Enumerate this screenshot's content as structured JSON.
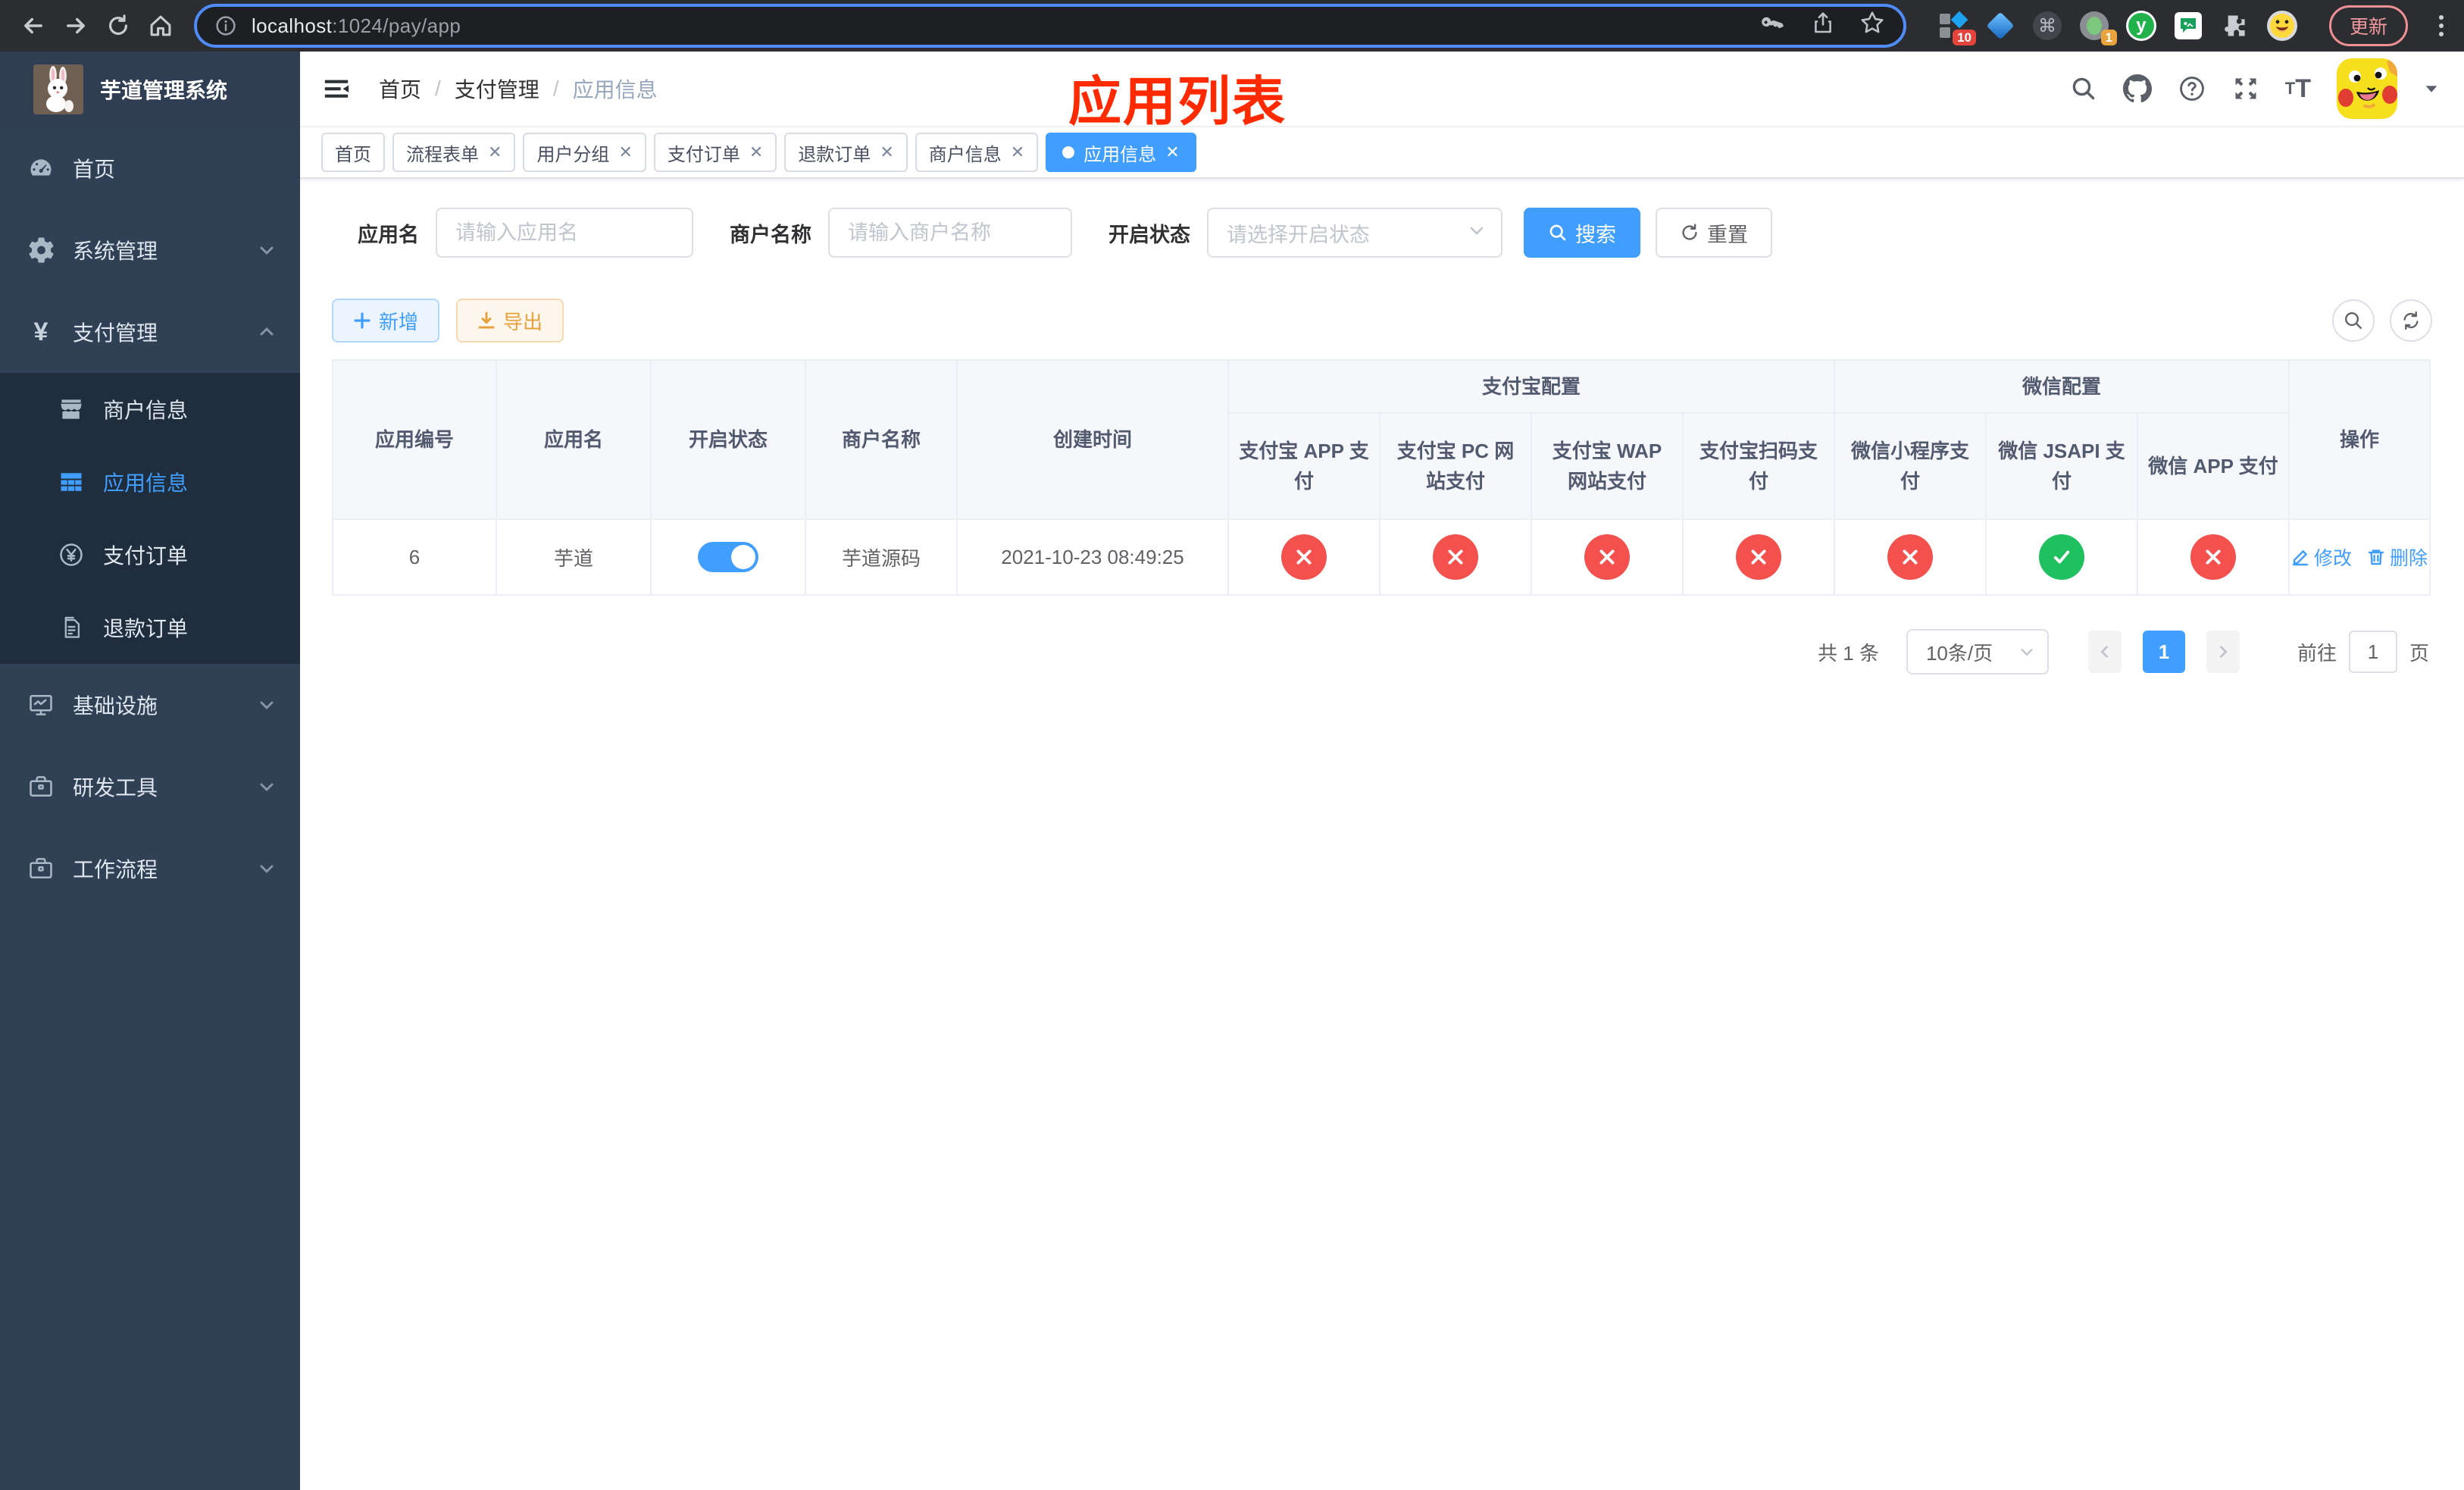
{
  "colors": {
    "accent": "#409eff",
    "danger": "#f4504e",
    "success": "#1ec05f",
    "annotation": "#ff2a00",
    "sidebar_bg": "#304156",
    "submenu_bg": "#1f2d3d"
  },
  "browser": {
    "url_host": "localhost",
    "url_rest": ":1024/pay/app",
    "update_label": "更新",
    "ext_badge_a": "10",
    "ext_badge_b": "1",
    "ext_y_label": "y",
    "cmd_glyph": "⌘"
  },
  "sidebar": {
    "title": "芋道管理系统",
    "items": [
      {
        "label": "首页"
      },
      {
        "label": "系统管理"
      },
      {
        "label": "支付管理"
      },
      {
        "label": "商户信息"
      },
      {
        "label": "应用信息"
      },
      {
        "label": "支付订单"
      },
      {
        "label": "退款订单"
      },
      {
        "label": "基础设施"
      },
      {
        "label": "研发工具"
      },
      {
        "label": "工作流程"
      }
    ]
  },
  "navbar": {
    "breadcrumb": [
      "首页",
      "支付管理",
      "应用信息"
    ],
    "annotation": "应用列表"
  },
  "tabs": [
    {
      "label": "首页"
    },
    {
      "label": "流程表单"
    },
    {
      "label": "用户分组"
    },
    {
      "label": "支付订单"
    },
    {
      "label": "退款订单"
    },
    {
      "label": "商户信息"
    },
    {
      "label": "应用信息"
    }
  ],
  "search": {
    "app_name_label": "应用名",
    "app_name_placeholder": "请输入应用名",
    "merchant_label": "商户名称",
    "merchant_placeholder": "请输入商户名称",
    "status_label": "开启状态",
    "status_placeholder": "请选择开启状态",
    "search_label": "搜索",
    "reset_label": "重置"
  },
  "toolbar": {
    "add_label": "新增",
    "export_label": "导出"
  },
  "table": {
    "columns": {
      "app_id": "应用编号",
      "app_name": "应用名",
      "status": "开启状态",
      "merchant": "商户名称",
      "created": "创建时间",
      "op": "操作"
    },
    "groups": {
      "alipay": "支付宝配置",
      "wechat": "微信配置"
    },
    "sub_columns": [
      "支付宝 APP 支付",
      "支付宝 PC 网站支付",
      "支付宝 WAP 网站支付",
      "支付宝扫码支付",
      "微信小程序支付",
      "微信 JSAPI 支付",
      "微信 APP 支付"
    ],
    "rows": [
      {
        "app_id": "6",
        "app_name": "芋道",
        "enabled": true,
        "merchant": "芋道源码",
        "created": "2021-10-23 08:49:25",
        "pay_configs": [
          false,
          false,
          false,
          false,
          false,
          true,
          false
        ]
      }
    ],
    "actions": {
      "edit": "修改",
      "delete": "删除"
    }
  },
  "pagination": {
    "total": "共 1 条",
    "page_size": "10条/页",
    "current_page": "1",
    "goto_prefix": "前往",
    "goto_value": "1",
    "goto_suffix": "页"
  }
}
